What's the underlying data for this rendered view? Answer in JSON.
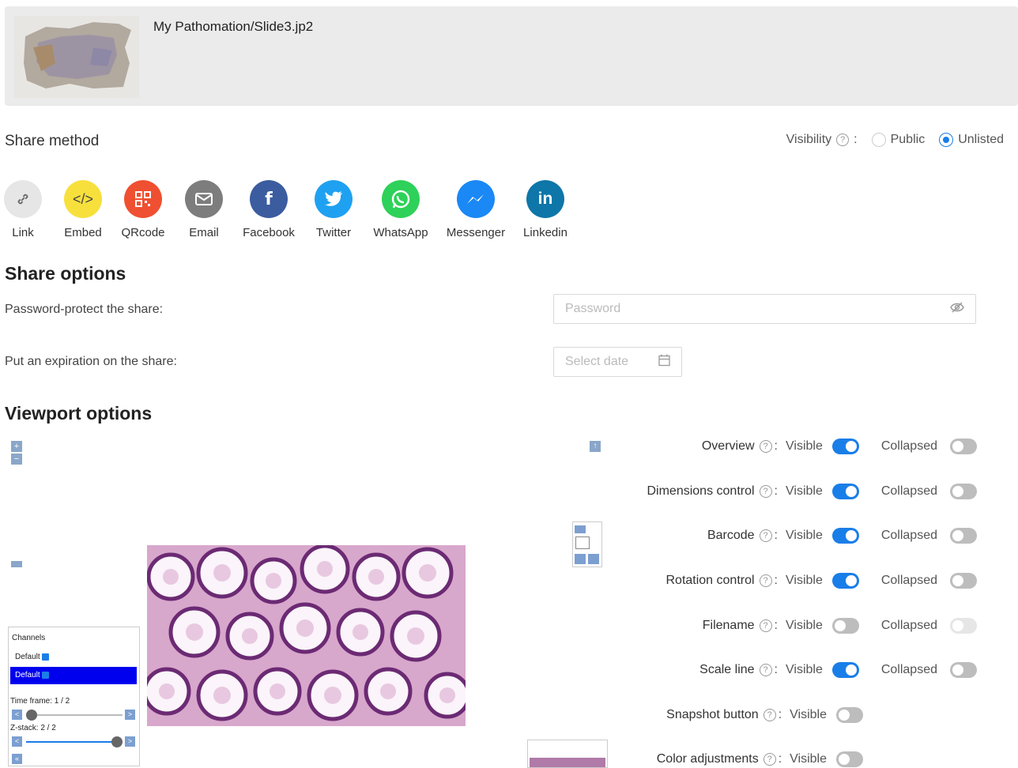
{
  "header": {
    "filename": "My Pathomation/Slide3.jp2"
  },
  "share_method": {
    "label": "Share method",
    "visibility_label": "Visibility",
    "options": [
      {
        "label": "Public",
        "selected": false
      },
      {
        "label": "Unlisted",
        "selected": true
      }
    ],
    "methods": [
      {
        "label": "Link",
        "color": "#e6e6e6",
        "icon": "link-icon"
      },
      {
        "label": "Embed",
        "color": "#f7e03c",
        "icon": "code-icon"
      },
      {
        "label": "QRcode",
        "color": "#ef5031",
        "icon": "qrcode-icon"
      },
      {
        "label": "Email",
        "color": "#7d7d7d",
        "icon": "mail-icon"
      },
      {
        "label": "Facebook",
        "color": "#3b5c9f",
        "icon": "facebook-icon"
      },
      {
        "label": "Twitter",
        "color": "#1fa1f1",
        "icon": "twitter-icon"
      },
      {
        "label": "WhatsApp",
        "color": "#2ed159",
        "icon": "whatsapp-icon"
      },
      {
        "label": "Messenger",
        "color": "#1a88f5",
        "icon": "messenger-icon"
      },
      {
        "label": "Linkedin",
        "color": "#0e76a8",
        "icon": "linkedin-icon"
      }
    ]
  },
  "share_options": {
    "title": "Share options",
    "password_label": "Password-protect the share:",
    "password_placeholder": "Password",
    "expiration_label": "Put an expiration on the share:",
    "date_placeholder": "Select date"
  },
  "viewport": {
    "title": "Viewport options",
    "visible_label": "Visible",
    "collapsed_label": "Collapsed",
    "rows": [
      {
        "name": "Overview",
        "visible": true,
        "collapsed": false,
        "collapsed_enabled": true
      },
      {
        "name": "Dimensions control",
        "visible": true,
        "collapsed": false,
        "collapsed_enabled": true
      },
      {
        "name": "Barcode",
        "visible": true,
        "collapsed": false,
        "collapsed_enabled": true
      },
      {
        "name": "Rotation control",
        "visible": true,
        "collapsed": false,
        "collapsed_enabled": true
      },
      {
        "name": "Filename",
        "visible": false,
        "collapsed": false,
        "collapsed_enabled": false
      },
      {
        "name": "Scale line",
        "visible": true,
        "collapsed": false,
        "collapsed_enabled": true
      },
      {
        "name": "Snapshot button",
        "visible": false
      },
      {
        "name": "Color adjustments",
        "visible": false
      }
    ],
    "preview": {
      "channels_title": "Channels",
      "channel_row1": "Default",
      "channel_row2": "Default",
      "time_frame": "Time frame: 1 / 2",
      "z_stack": "Z-stack: 2 / 2"
    }
  },
  "colors": {
    "accent": "#1a7ee8",
    "header_bg": "#ebebeb"
  }
}
